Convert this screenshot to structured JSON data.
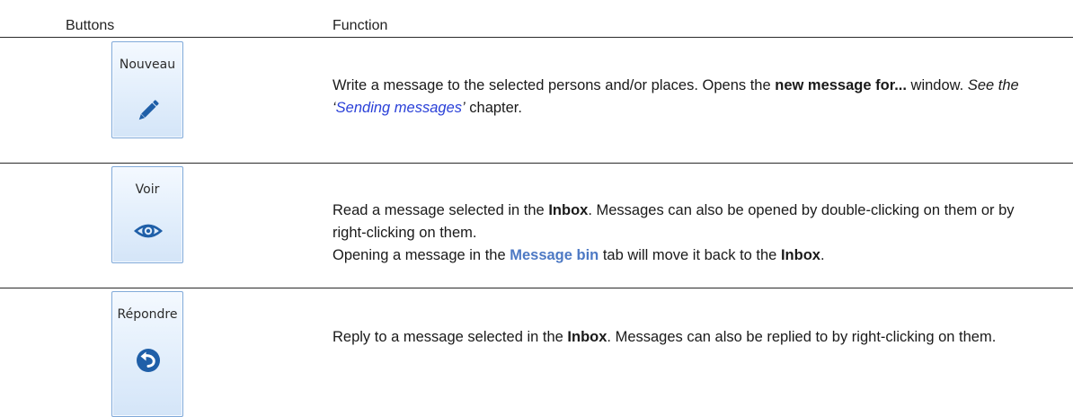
{
  "header": {
    "buttons": "Buttons",
    "function": "Function"
  },
  "rows": [
    {
      "button_label": "Nouveau",
      "icon": "pencil-icon",
      "desc": {
        "p1": "Write a message to the selected persons and/or places. Opens the ",
        "b1": "new message for...",
        "p2": " window. ",
        "i1": "See the ‘",
        "link": "Sending messages",
        "i2": "’",
        "p3": " chapter."
      }
    },
    {
      "button_label": "Voir",
      "icon": "eye-icon",
      "desc": {
        "p1": "Read a message selected in the ",
        "b1": "Inbox",
        "p2": ". Messages can also be opened by double-clicking on them or by right-clicking on them.",
        "p3": "Opening a message in the ",
        "tab": "Message bin",
        "p4": " tab will move it back to the ",
        "b2": "Inbox",
        "p5": "."
      }
    },
    {
      "button_label": "Répondre",
      "icon": "reply-icon",
      "desc": {
        "p1": "Reply to a message selected in the ",
        "b1": "Inbox",
        "p2": ". Messages can also be replied to by right-clicking on them."
      }
    }
  ],
  "colors": {
    "link": "#2a40d8",
    "tab_name": "#4d79c4",
    "button_border": "#7fa9d9",
    "icon_blue": "#1f5fa8"
  }
}
